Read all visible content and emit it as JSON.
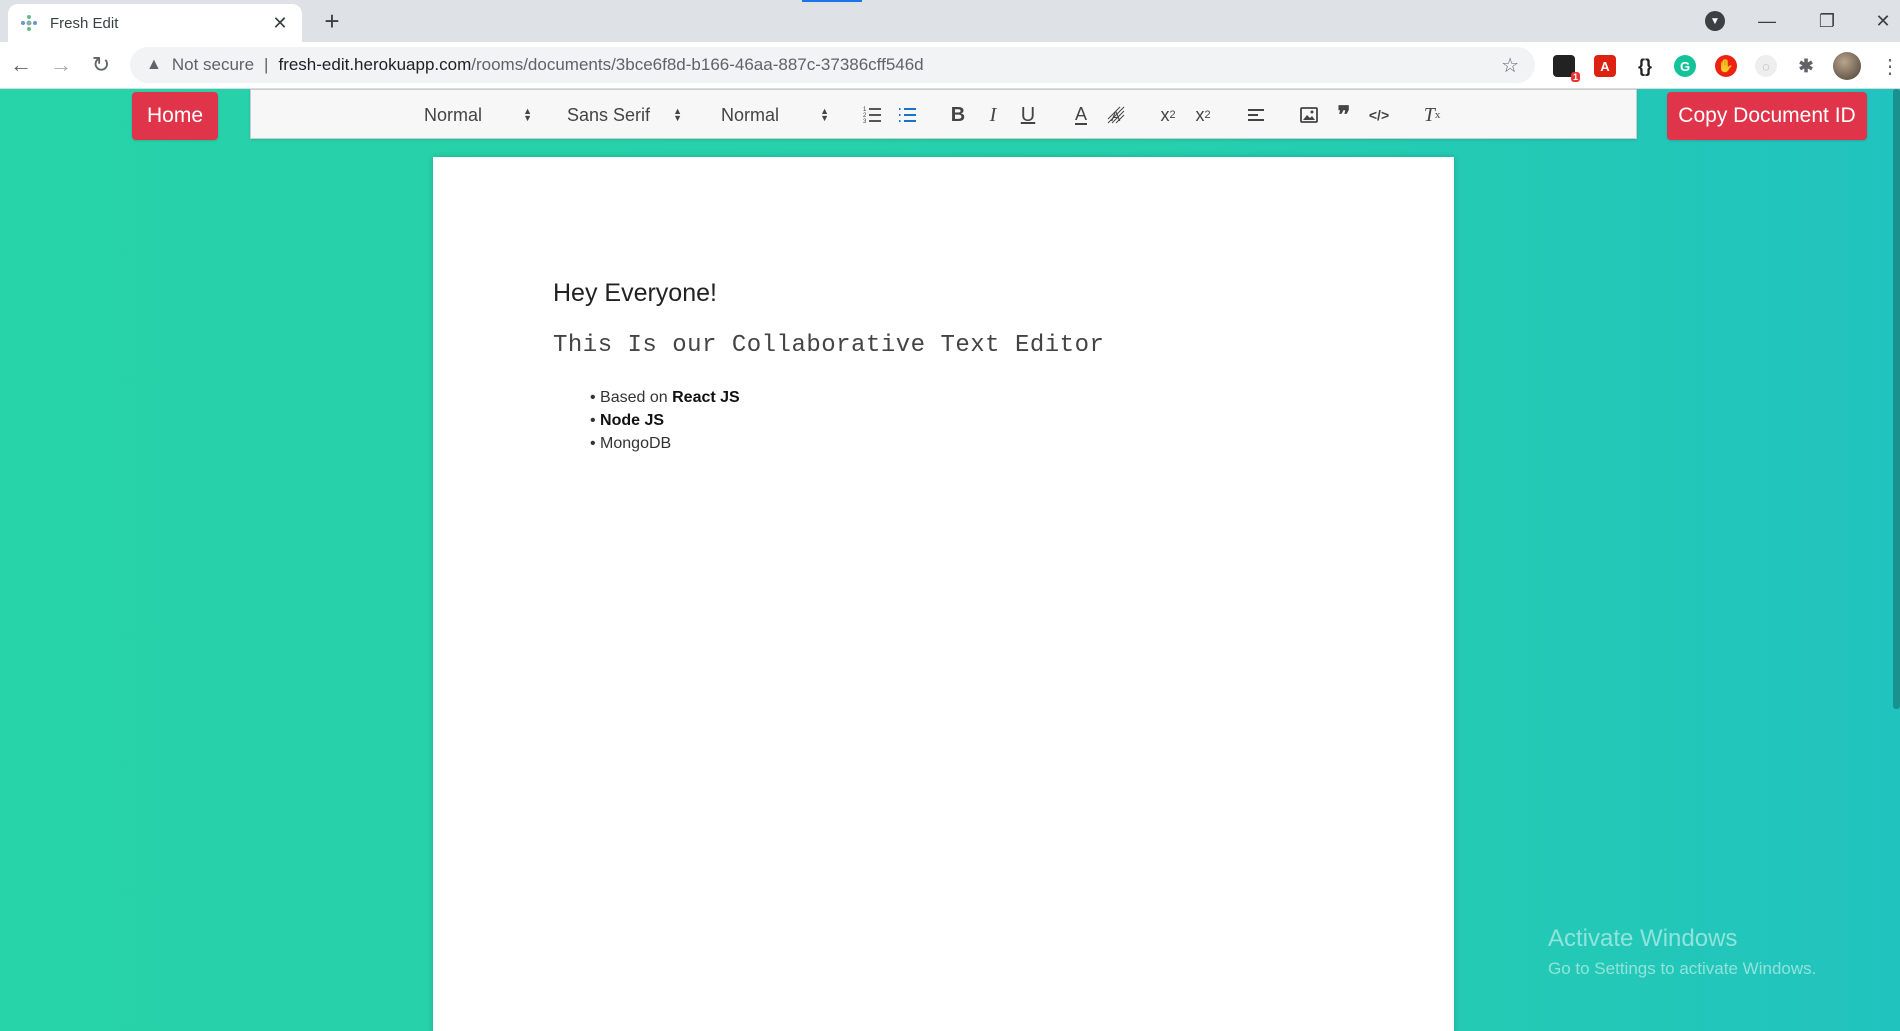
{
  "browser": {
    "tab_title": "Fresh Edit",
    "new_tab_label": "+",
    "address": {
      "warning_label": "Not secure",
      "separator": "|",
      "host": "fresh-edit.herokuapp.com",
      "path": "/rooms/documents/3bce6f8d-b166-46aa-887c-37386cff546d"
    },
    "extension_badge": "1",
    "extensions": [
      "acrobat-icon",
      "json-icon",
      "grammarly-icon",
      "adblock-icon",
      "ghost-icon",
      "puzzle-icon"
    ]
  },
  "app": {
    "home_label": "Home",
    "copy_label": "Copy Document ID",
    "toolbar": {
      "heading_picker": "Normal",
      "font_picker": "Sans Serif",
      "size_picker": "Normal"
    },
    "document": {
      "heading": "Hey Everyone!",
      "subheading": "This Is our Collaborative Text Editor",
      "list": {
        "item1_prefix": "Based on ",
        "item1_bold": "React JS",
        "item2_bold": "Node JS",
        "item3": "MongoDB"
      }
    },
    "watermark": {
      "title": "Activate Windows",
      "subtitle": "Go to Settings to activate Windows."
    },
    "colors": {
      "background": "#27d3a9",
      "button": "#e0344a",
      "active_icon": "#0066cc"
    }
  }
}
